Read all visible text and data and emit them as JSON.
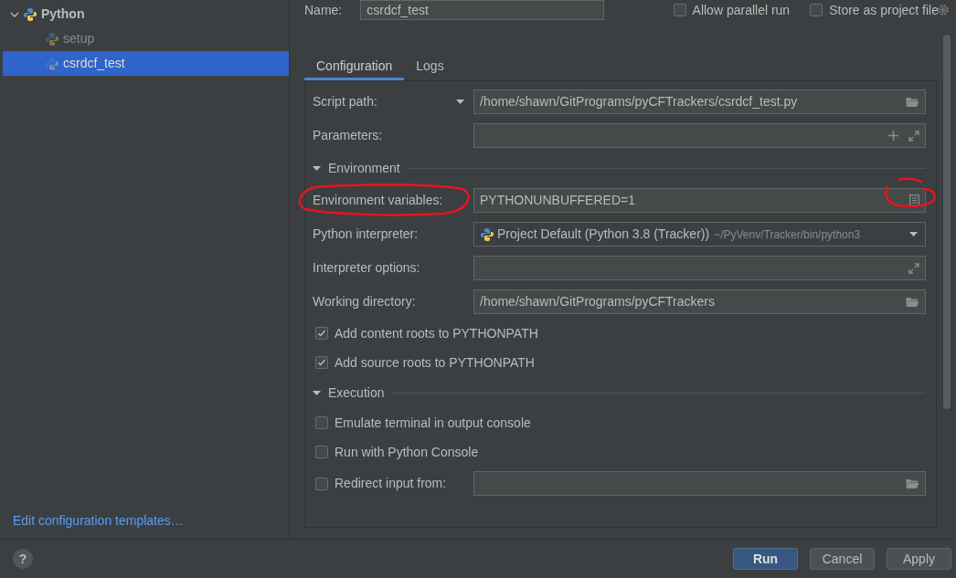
{
  "sidebar": {
    "tree": [
      {
        "label": "Python",
        "expanded": true,
        "children": [
          {
            "label": "setup",
            "selected": false
          },
          {
            "label": "csrdcf_test",
            "selected": true
          }
        ]
      }
    ],
    "link": "Edit configuration templates…"
  },
  "header": {
    "name_label": "Name:",
    "name_value": "csrdcf_test",
    "options": [
      {
        "label": "Allow parallel run",
        "checked": false
      },
      {
        "label": "Store as project file",
        "checked": false
      }
    ]
  },
  "tabs": [
    {
      "label": "Configuration",
      "selected": true
    },
    {
      "label": "Logs",
      "selected": false
    }
  ],
  "form": [
    {
      "kind": "field",
      "label": "Script path:",
      "label_dropdown": true,
      "value": "/home/shawn/GitPrograms/pyCFTrackers/csrdcf_test.py",
      "icons": [
        {
          "kind": "browse"
        }
      ]
    },
    {
      "kind": "field",
      "label": "Parameters:",
      "icons": [
        {
          "kind": "add"
        },
        {
          "kind": "expand"
        }
      ]
    },
    {
      "kind": "section",
      "label": "Environment",
      "expanded": true
    },
    {
      "kind": "field",
      "label": "Environment variables:",
      "value": "PYTHONUNBUFFERED=1",
      "icons": [
        {
          "kind": "list"
        }
      ],
      "annotated": true
    },
    {
      "kind": "select",
      "label": "Python interpreter:",
      "value": "Project Default (Python 3.8 (Tracker))",
      "hint": "~/PyVenv/Tracker/bin/python3"
    },
    {
      "kind": "field",
      "label": "Interpreter options:",
      "icons": [
        {
          "kind": "expand"
        }
      ]
    },
    {
      "kind": "field",
      "label": "Working directory:",
      "value": "/home/shawn/GitPrograms/pyCFTrackers",
      "icons": [
        {
          "kind": "browse"
        }
      ]
    },
    {
      "kind": "checkbox",
      "label": "Add content roots to PYTHONPATH",
      "checked": true
    },
    {
      "kind": "checkbox",
      "label": "Add source roots to PYTHONPATH",
      "checked": true
    },
    {
      "kind": "section",
      "label": "Execution",
      "expanded": true
    },
    {
      "kind": "checkbox",
      "label": "Emulate terminal in output console",
      "checked": false
    },
    {
      "kind": "checkbox",
      "label": "Run with Python Console",
      "checked": false
    },
    {
      "kind": "checkbox_field",
      "label": "Redirect input from:",
      "checked": false,
      "icons": [
        {
          "kind": "browse"
        }
      ]
    }
  ],
  "footer": {
    "help": "?",
    "buttons": [
      {
        "label": "Run",
        "primary": true
      },
      {
        "label": "Cancel",
        "primary": false
      },
      {
        "label": "Apply",
        "primary": false
      }
    ]
  }
}
